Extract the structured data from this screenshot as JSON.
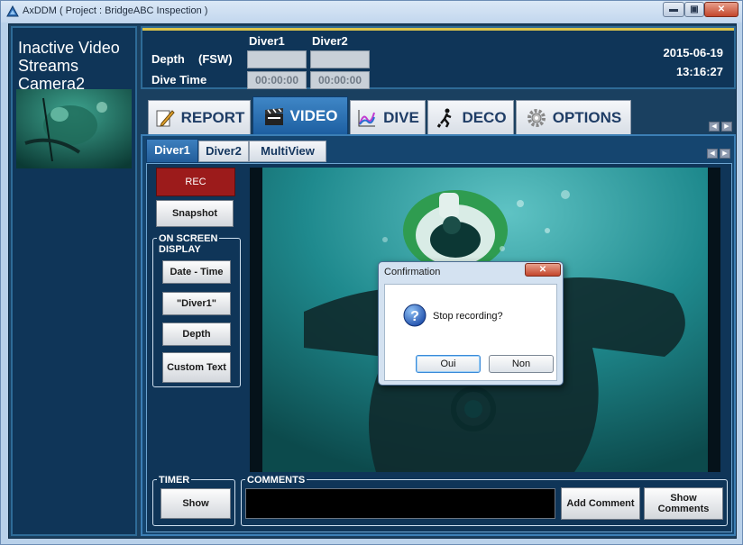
{
  "window": {
    "title": "AxDDM ( Project : BridgeABC Inspection )",
    "controls": {
      "minimize": "▬",
      "maximize": "▣",
      "close": "✕"
    }
  },
  "left_panel": {
    "label": "Inactive Video\nStreams\nCamera2"
  },
  "header": {
    "depth_label": "Depth",
    "unit_label": "(FSW)",
    "dive_time_label": "Dive Time",
    "diver1_label": "Diver1",
    "diver2_label": "Diver2",
    "diver1_depth": "",
    "diver2_depth": "",
    "diver1_time": "00:00:00",
    "diver2_time": "00:00:00",
    "date": "2015-06-19",
    "time": "13:16:27"
  },
  "main_tabs": [
    {
      "label": "REPORT",
      "icon": "pencil-icon"
    },
    {
      "label": "VIDEO",
      "icon": "clapperboard-icon",
      "active": true
    },
    {
      "label": "DIVE",
      "icon": "graph-icon"
    },
    {
      "label": "DECO",
      "icon": "diver-icon"
    },
    {
      "label": "OPTIONS",
      "icon": "gear-icon"
    }
  ],
  "scroll": {
    "left": "◀",
    "right": "▶"
  },
  "sub_tabs": [
    {
      "label": "Diver1",
      "active": true
    },
    {
      "label": "Diver2"
    },
    {
      "label": "MultiView"
    }
  ],
  "controls": {
    "rec": "REC",
    "snapshot": "Snapshot",
    "osd_group": "ON SCREEN\nDISPLAY",
    "date_time": "Date - Time",
    "diver_name": "\"Diver1\"",
    "depth": "Depth",
    "custom_text": "Custom Text",
    "timer_group": "TIMER",
    "timer_show": "Show",
    "comments_group": "COMMENTS",
    "add_comment": "Add Comment",
    "show_comments": "Show\nComments"
  },
  "dialog": {
    "title": "Confirmation",
    "close": "✕",
    "message": "Stop recording?",
    "yes": "Oui",
    "no": "Non",
    "icon": "question-icon"
  },
  "colors": {
    "accent": "#d9c24a",
    "active_tab": "#2a6fb0",
    "rec": "#9c1b1b",
    "panel": "#0f3558"
  }
}
